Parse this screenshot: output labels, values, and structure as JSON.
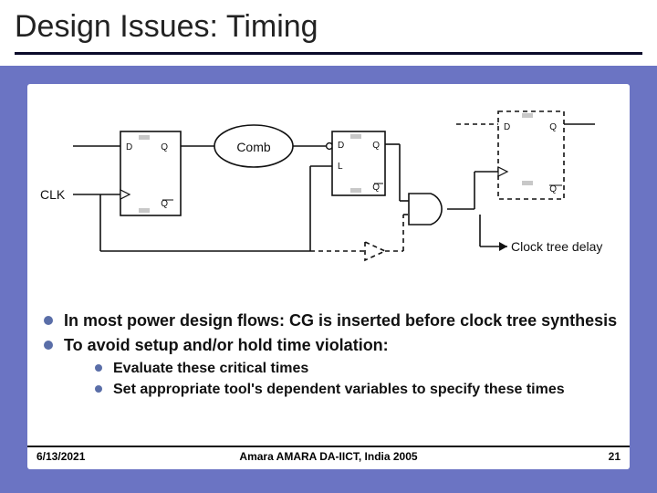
{
  "title": "Design Issues: Timing",
  "diagram": {
    "clk": "CLK",
    "ff1": {
      "D": "D",
      "Q": "Q",
      "Qb": "Q"
    },
    "comb": "Comb",
    "latch": {
      "D": "D",
      "Q": "Q",
      "L": "L",
      "Qb": "Q"
    },
    "ff2": {
      "D": "D",
      "Q": "Q",
      "Qb": "Q"
    },
    "delay": "Clock tree delay"
  },
  "bullets": {
    "b1": "In most power design flows: CG is inserted before clock tree synthesis",
    "b2": "To avoid setup and/or hold time violation:",
    "sub1": "Evaluate these critical times",
    "sub2": "Set appropriate tool's dependent variables to specify these times"
  },
  "footer": {
    "date": "6/13/2021",
    "center": "Amara AMARA DA-IICT, India 2005",
    "page": "21"
  }
}
